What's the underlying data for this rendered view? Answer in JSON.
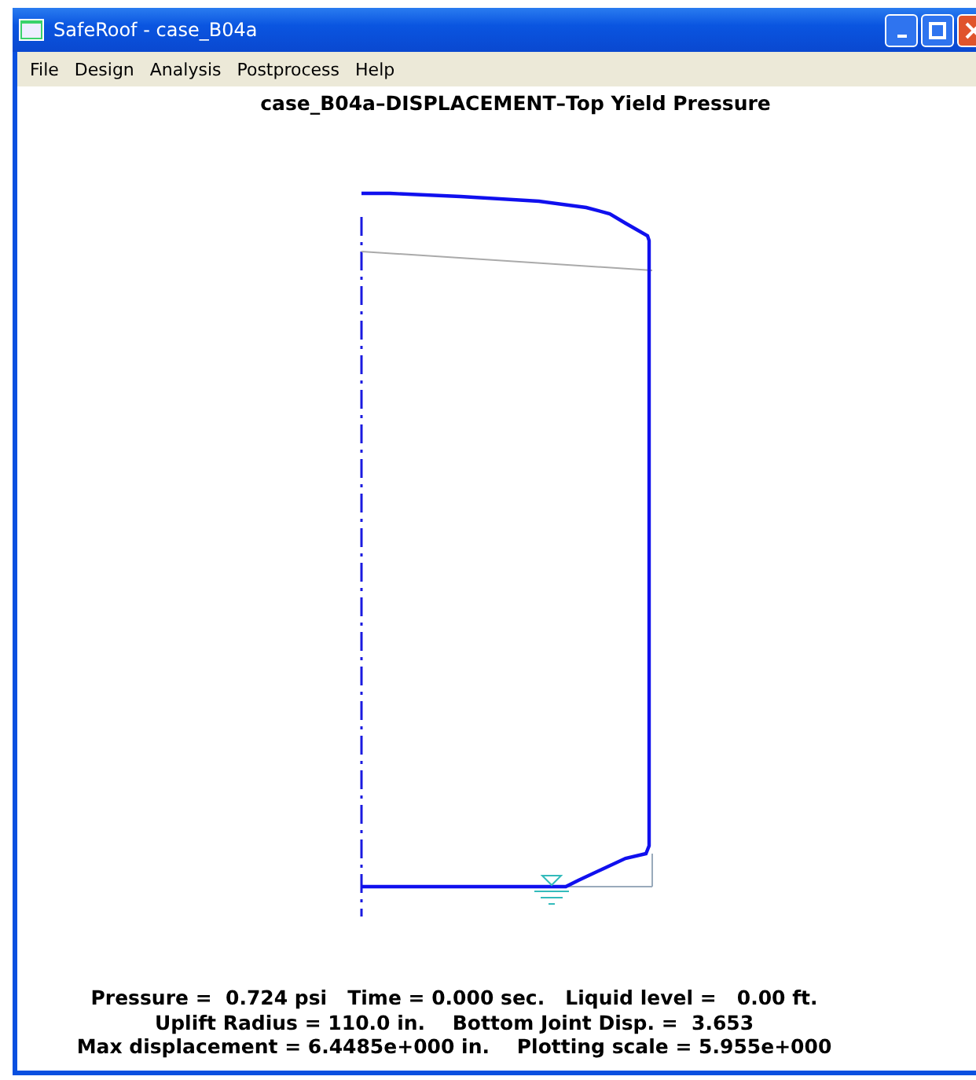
{
  "window": {
    "title": "SafeRoof - case_B04a"
  },
  "menu": [
    {
      "label": "File"
    },
    {
      "label": "Design"
    },
    {
      "label": "Analysis"
    },
    {
      "label": "Postprocess"
    },
    {
      "label": "Help"
    }
  ],
  "plot": {
    "title": "case_B04a–DISPLACEMENT–Top Yield Pressure",
    "info_lines": [
      "Pressure =  0.724 psi   Time = 0.000 sec.   Liquid level =   0.00 ft.",
      "Uplift Radius = 110.0 in.    Bottom Joint Disp. =  3.653",
      "Max displacement = 6.4485e+000 in.    Plotting scale = 5.955e+000"
    ]
  }
}
